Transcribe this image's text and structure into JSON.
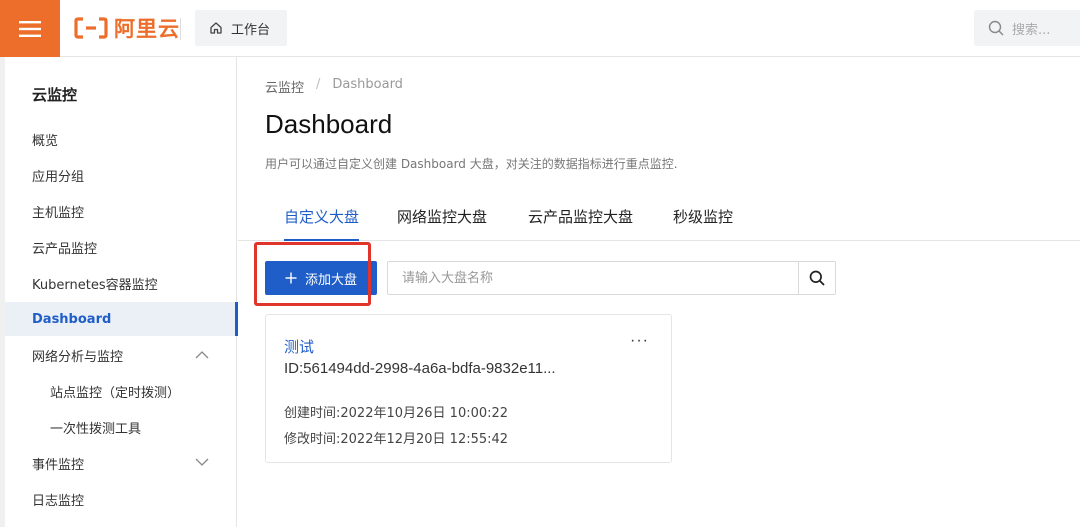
{
  "header": {
    "logo_text": "阿里云",
    "workbench_label": "工作台",
    "search_placeholder": "搜索..."
  },
  "sidebar": {
    "title": "云监控",
    "items": [
      {
        "label": "概览"
      },
      {
        "label": "应用分组"
      },
      {
        "label": "主机监控"
      },
      {
        "label": "云产品监控"
      },
      {
        "label": "Kubernetes容器监控"
      },
      {
        "label": "Dashboard"
      },
      {
        "label": "网络分析与监控"
      },
      {
        "label": "站点监控（定时拨测）"
      },
      {
        "label": "一次性拨测工具"
      },
      {
        "label": "事件监控"
      },
      {
        "label": "日志监控"
      }
    ]
  },
  "main": {
    "breadcrumb": [
      "云监控",
      "Dashboard"
    ],
    "breadcrumb_sep": "/",
    "title": "Dashboard",
    "description": "用户可以通过自定义创建 Dashboard 大盘，对关注的数据指标进行重点监控.",
    "tabs": [
      {
        "label": "自定义大盘"
      },
      {
        "label": "网络监控大盘"
      },
      {
        "label": "云产品监控大盘"
      },
      {
        "label": "秒级监控"
      }
    ],
    "add_button_label": "添加大盘",
    "search_placeholder": "请输入大盘名称",
    "card": {
      "name": "测试",
      "id": "ID:561494dd-2998-4a6a-bdfa-9832e11...",
      "created": "创建时间:2022年10月26日 10:00:22",
      "modified": "修改时间:2022年12月20日 12:55:42",
      "more": "···"
    }
  },
  "colors": {
    "brand_orange": "#ed6e2b",
    "primary_blue": "#1f5ec8",
    "highlight_red": "#e0352b"
  }
}
